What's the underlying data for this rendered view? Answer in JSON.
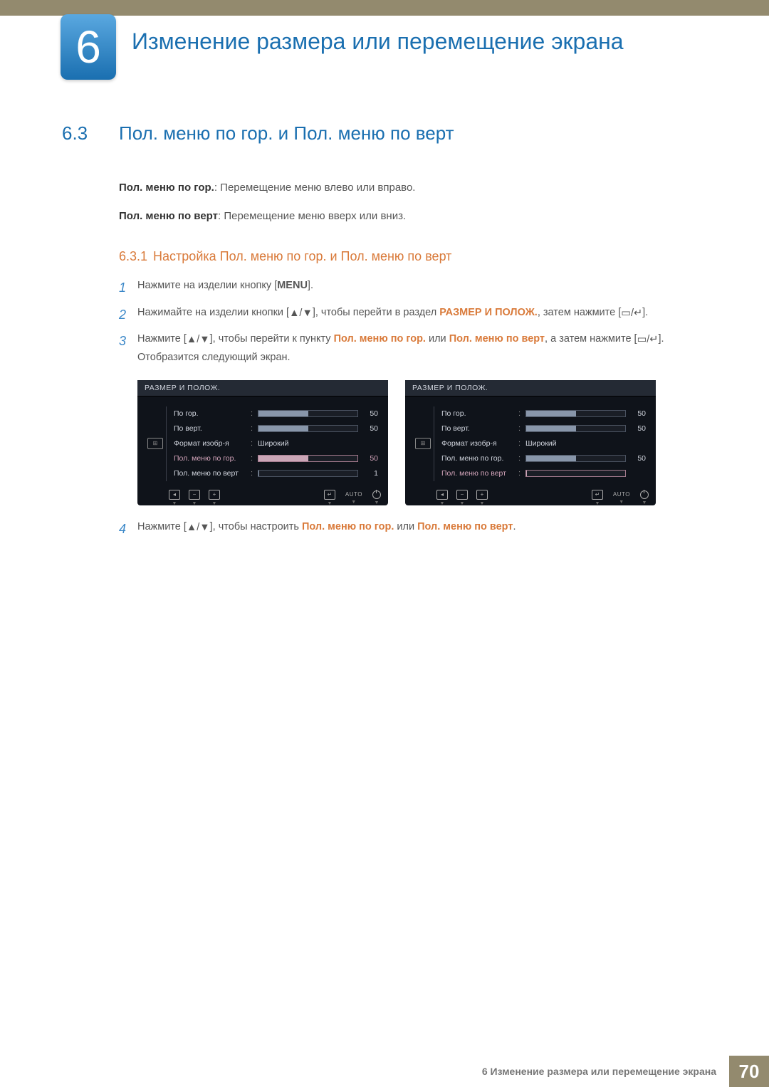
{
  "header": {
    "chapter_number": "6",
    "chapter_title": "Изменение размера или перемещение экрана"
  },
  "section": {
    "number": "6.3",
    "title": "Пол. меню по гор. и Пол. меню по верт"
  },
  "intro": {
    "h_label": "Пол. меню по гор.",
    "h_desc": ": Перемещение меню влево или вправо.",
    "v_label": "Пол. меню по верт",
    "v_desc": ": Перемещение меню вверх или вниз."
  },
  "subsection": {
    "number": "6.3.1",
    "title": "Настройка Пол. меню по гор. и Пол. меню по верт"
  },
  "steps": {
    "s1_pre": "Нажмите на изделии кнопку [",
    "s1_menu": "MENU",
    "s1_post": "].",
    "s2_pre": "Нажимайте на изделии кнопки [",
    "s2_post1": "], чтобы перейти в раздел ",
    "s2_hl": "РАЗМЕР И ПОЛОЖ.",
    "s2_post2": ", затем нажмите [",
    "s2_post3": "].",
    "s3_pre": "Нажмите [",
    "s3_post1": "], чтобы перейти к пункту ",
    "s3_hl1": "Пол. меню по гор.",
    "s3_mid": " или ",
    "s3_hl2": "Пол. меню по верт",
    "s3_post2": ", а затем нажмите [",
    "s3_post3": "]. Отобразится следующий экран.",
    "s4_pre": "Нажмите [",
    "s4_post1": "], чтобы настроить ",
    "s4_hl1": "Пол. меню по гор.",
    "s4_mid": " или ",
    "s4_hl2": "Пол. меню по верт",
    "s4_post2": "."
  },
  "osd": {
    "title": "РАЗМЕР И ПОЛОЖ.",
    "rows": {
      "h_pos": "По гор.",
      "v_pos": "По верт.",
      "image_size": "Формат изобр-я",
      "menu_h": "Пол. меню по гор.",
      "menu_v": "Пол. меню по верт"
    },
    "wide": "Широкий",
    "val50": "50",
    "val1": "1",
    "auto": "AUTO"
  },
  "footer": {
    "text": "6 Изменение размера или перемещение экрана",
    "page": "70"
  }
}
